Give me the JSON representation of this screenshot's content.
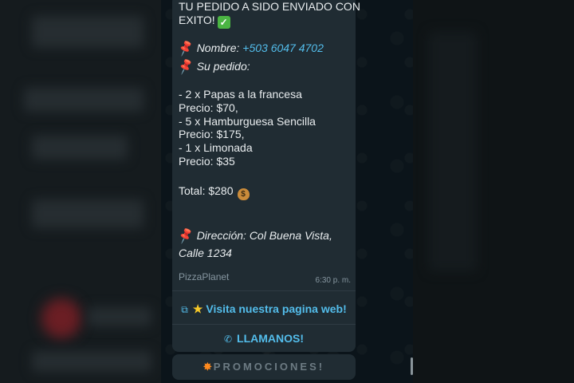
{
  "message": {
    "heading_line1": "TU PEDIDO A SIDO ENVIADO CON",
    "heading_line2": "EXITO!",
    "check_emoji": "✓",
    "pin_emoji": "📌",
    "nombre_label": "Nombre:",
    "phone": "+503 6047 4702",
    "pedido_label": "Su pedido:",
    "items": [
      "- 2 x Papas a la francesa",
      "Precio: $70,",
      "- 5 x Hamburguesa Sencilla",
      "Precio: $175,",
      "- 1 x Limonada",
      "Precio: $35"
    ],
    "total": "Total: $280",
    "money_bag_emoji": "$",
    "direccion_line1": "Dirección: Col Buena Vista,",
    "direccion_line2": "Calle 1234",
    "sender": "PizzaPlanet",
    "time": "6:30 p. m."
  },
  "actions": {
    "website_label": "Visita nuestra pagina web!",
    "call_label": "LLAMANOS!"
  },
  "promo": {
    "label": "PROMOCIONES!"
  },
  "colors": {
    "bubble": "#202c33",
    "text": "#e9edef",
    "link": "#53bdeb",
    "meta": "#8696a0",
    "background": "#0b141a"
  },
  "icons": [
    "check-emoji-icon",
    "pushpin-icon",
    "money-bag-icon",
    "external-link-icon",
    "star-icon",
    "phone-icon",
    "burst-icon"
  ]
}
